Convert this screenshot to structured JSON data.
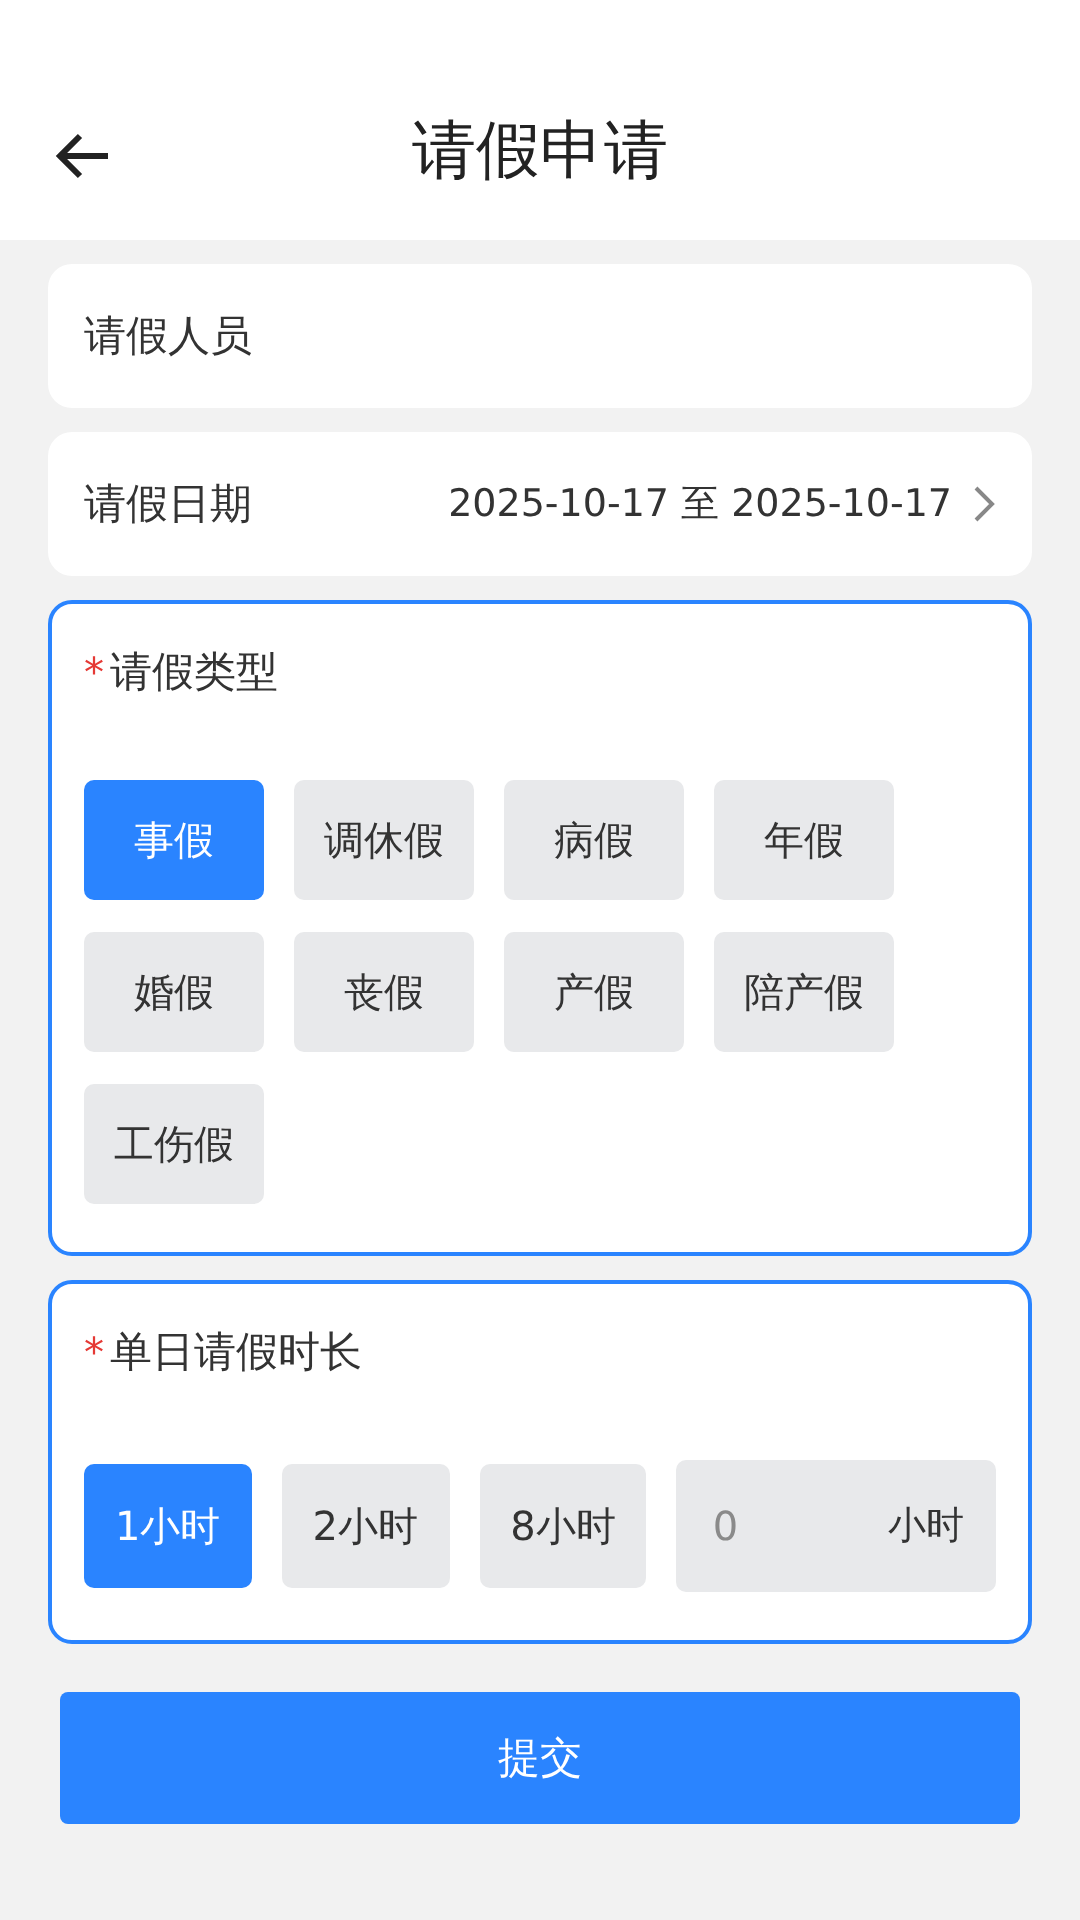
{
  "header": {
    "title": "请假申请"
  },
  "applicant": {
    "label": "请假人员"
  },
  "date": {
    "label": "请假日期",
    "value": "2025-10-17 至 2025-10-17"
  },
  "leave_type": {
    "required_mark": "*",
    "label": "请假类型",
    "options": [
      {
        "label": "事假",
        "selected": true
      },
      {
        "label": "调休假",
        "selected": false
      },
      {
        "label": "病假",
        "selected": false
      },
      {
        "label": "年假",
        "selected": false
      },
      {
        "label": "婚假",
        "selected": false
      },
      {
        "label": "丧假",
        "selected": false
      },
      {
        "label": "产假",
        "selected": false
      },
      {
        "label": "陪产假",
        "selected": false
      },
      {
        "label": "工伤假",
        "selected": false
      }
    ]
  },
  "duration": {
    "required_mark": "*",
    "label": "单日请假时长",
    "options": [
      {
        "label": "1小时",
        "selected": true
      },
      {
        "label": "2小时",
        "selected": false
      },
      {
        "label": "8小时",
        "selected": false
      }
    ],
    "custom": {
      "placeholder": "0",
      "unit": "小时"
    }
  },
  "submit": "提交"
}
